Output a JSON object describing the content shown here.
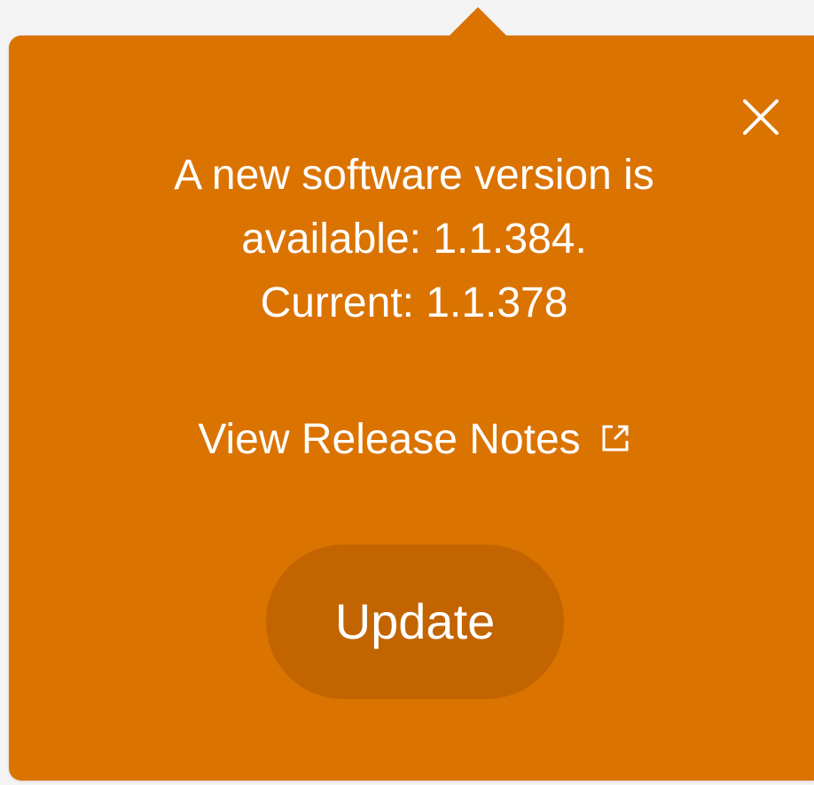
{
  "colors": {
    "background": "#f3f3f3",
    "popover": "#db7300",
    "button": "#c26400",
    "text": "#ffffff"
  },
  "notification": {
    "message_lines": [
      "A new software version is",
      "available: 1.1.384.",
      "Current: 1.1.378"
    ],
    "new_version": "1.1.384",
    "current_version": "1.1.378",
    "release_notes_label": "View Release Notes",
    "release_notes_icon": "external-link-icon",
    "close_icon": "close-icon",
    "update_label": "Update"
  }
}
